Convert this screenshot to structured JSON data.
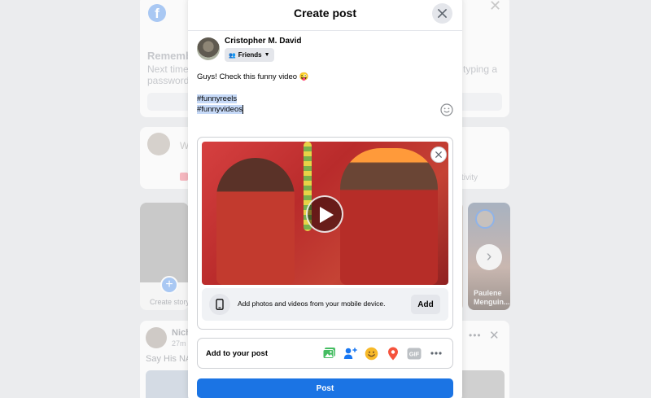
{
  "background": {
    "remember_title": "Rememb",
    "next_time_text": "Next time password.",
    "typing_text": "typing a",
    "composer_placeholder_fragment": "W",
    "activity_text": "tivity",
    "create_story_label": "Create story",
    "story_name": "Paulene Menguin...",
    "post_author_fragment": "Nich",
    "post_time": "27m",
    "post_text_fragment": "Say His NAM"
  },
  "modal": {
    "title": "Create post",
    "user": {
      "name": "Cristopher M. David",
      "audience_label": "Friends"
    },
    "post_text": "Guys! Check this funny video 😜",
    "hashtags": [
      "#funnyreels",
      "#funnyvideos"
    ],
    "mobile_upload_text": "Add photos and videos from your mobile device.",
    "mobile_add_label": "Add",
    "add_to_post_label": "Add to your post",
    "tools": [
      "photo-video",
      "tag-people",
      "feeling-activity",
      "check-in",
      "gif",
      "more"
    ],
    "gif_label": "GIF",
    "post_button_label": "Post"
  },
  "colors": {
    "accent": "#1b74e4",
    "photo_green": "#45bd62",
    "tag_blue": "#1877f2",
    "feeling_yellow": "#f7b928",
    "checkin_red": "#f5533d"
  }
}
